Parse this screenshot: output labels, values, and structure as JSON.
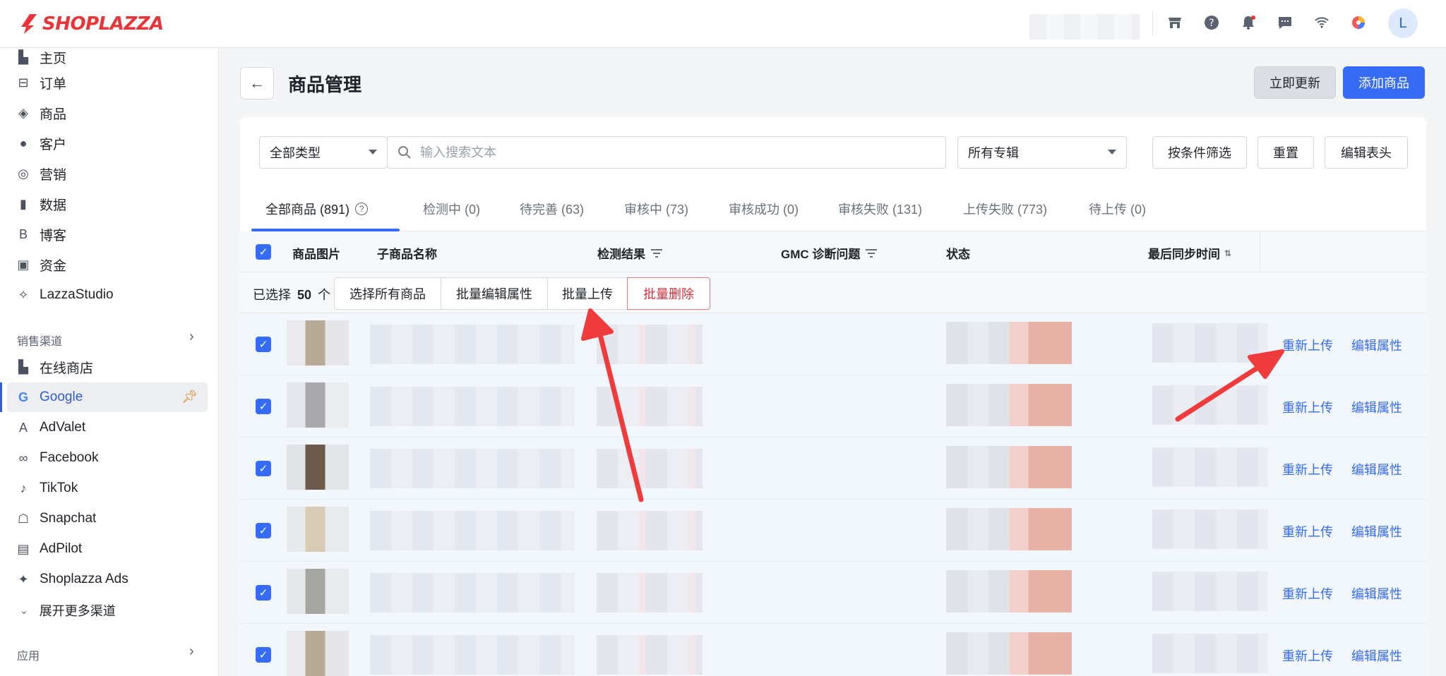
{
  "brand": {
    "name": "SHOPLAZZA",
    "color": "#e8353a"
  },
  "header": {
    "icons": [
      "store-icon",
      "help-icon",
      "notification-icon",
      "message-icon",
      "wifi-icon",
      "app-switch-icon"
    ],
    "avatar_initial": "L"
  },
  "sidebar": {
    "items": [
      {
        "label": "主页",
        "icon": "home-icon"
      },
      {
        "label": "订单",
        "icon": "inbox-icon"
      },
      {
        "label": "商品",
        "icon": "tag-icon"
      },
      {
        "label": "客户",
        "icon": "person-icon"
      },
      {
        "label": "营销",
        "icon": "target-icon"
      },
      {
        "label": "数据",
        "icon": "bar-chart-icon"
      },
      {
        "label": "博客",
        "icon": "blog-icon"
      },
      {
        "label": "资金",
        "icon": "wallet-icon"
      },
      {
        "label": "LazzaStudio",
        "icon": "sparkle-icon"
      }
    ],
    "sales_channels_title": "销售渠道",
    "channels": [
      {
        "label": "在线商店",
        "icon": "store-icon"
      },
      {
        "label": "Google",
        "icon": "google-icon",
        "active": true
      },
      {
        "label": "AdValet",
        "icon": "advalet-icon"
      },
      {
        "label": "Facebook",
        "icon": "meta-icon"
      },
      {
        "label": "TikTok",
        "icon": "tiktok-icon"
      },
      {
        "label": "Snapchat",
        "icon": "snapchat-icon"
      },
      {
        "label": "AdPilot",
        "icon": "adpilot-icon"
      },
      {
        "label": "Shoplazza Ads",
        "icon": "shoplazza-ads-icon"
      }
    ],
    "expand_more": "展开更多渠道",
    "apps_title": "应用"
  },
  "page": {
    "title": "商品管理",
    "refresh_label": "立即更新",
    "add_label": "添加商品"
  },
  "filters": {
    "type_select": "全部类型",
    "search_placeholder": "输入搜索文本",
    "collection_select": "所有专辑",
    "condition_filter": "按条件筛选",
    "reset": "重置",
    "edit_columns": "编辑表头"
  },
  "tabs": [
    {
      "label": "全部商品 (891)",
      "active": true
    },
    {
      "label": "检测中 (0)"
    },
    {
      "label": "待完善 (63)"
    },
    {
      "label": "审核中 (73)"
    },
    {
      "label": "审核成功 (0)"
    },
    {
      "label": "审核失败 (131)"
    },
    {
      "label": "上传失败 (773)"
    },
    {
      "label": "待上传 (0)"
    }
  ],
  "table": {
    "columns": {
      "image": "商品图片",
      "name": "子商品名称",
      "detection": "检测结果",
      "gmc": "GMC 诊断问题",
      "status": "状态",
      "last_sync": "最后同步时间"
    },
    "bulk": {
      "selected_prefix": "已选择",
      "selected_count": "50",
      "selected_suffix": "个",
      "select_all": "选择所有商品",
      "batch_edit": "批量编辑属性",
      "batch_upload": "批量上传",
      "batch_delete": "批量删除"
    },
    "row_actions": {
      "reupload": "重新上传",
      "edit_attrs": "编辑属性"
    },
    "row_count_visible": 6
  },
  "colors": {
    "accent": "#356bf5",
    "danger": "#d9303a",
    "annotation_arrow": "#ef3b3b"
  }
}
